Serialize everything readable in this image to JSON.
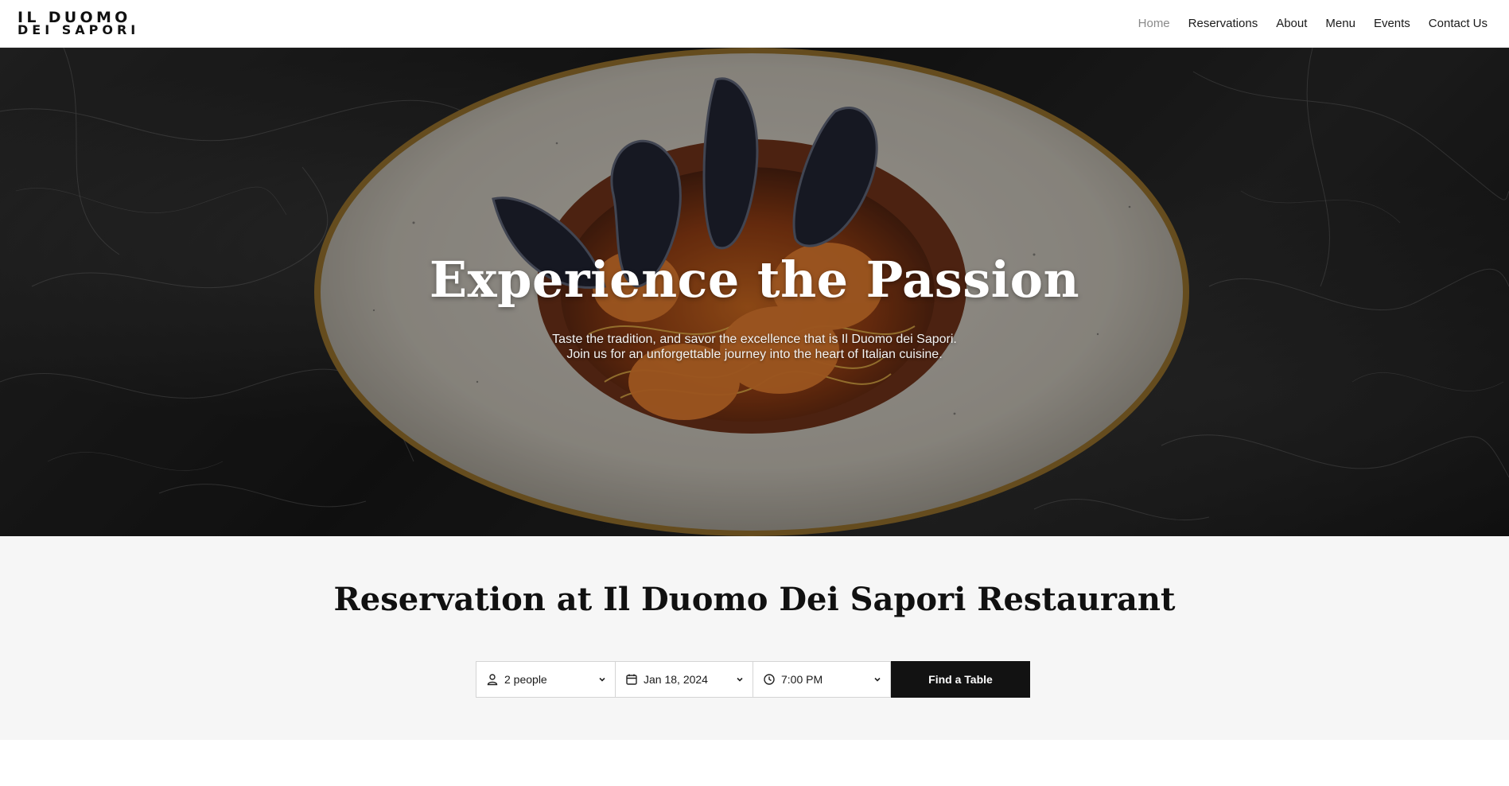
{
  "brand": {
    "line1": "IL DUOMO",
    "line2": "DEI SAPORI"
  },
  "nav": {
    "items": [
      {
        "label": "Home",
        "active": true
      },
      {
        "label": "Reservations"
      },
      {
        "label": "About"
      },
      {
        "label": "Menu"
      },
      {
        "label": "Events"
      },
      {
        "label": "Contact Us"
      }
    ]
  },
  "hero": {
    "title": "Experience the Passion",
    "subtitle_line1": "Taste the tradition, and savor the excellence that is Il Duomo dei Sapori.",
    "subtitle_line2": "Join us for an unforgettable journey into the heart of Italian cuisine."
  },
  "reservation": {
    "title": "Reservation at Il Duomo Dei Sapori Restaurant",
    "party_size": "2 people",
    "date": "Jan 18, 2024",
    "time": "7:00 PM",
    "submit_label": "Find a Table"
  },
  "icons": {
    "party": "person-icon",
    "date": "calendar-icon",
    "time": "clock-icon",
    "dropdown": "chevron-down-icon"
  },
  "colors": {
    "nav_active": "#8a8a8a",
    "button_bg": "#121212",
    "section_bg": "#f6f6f6"
  }
}
